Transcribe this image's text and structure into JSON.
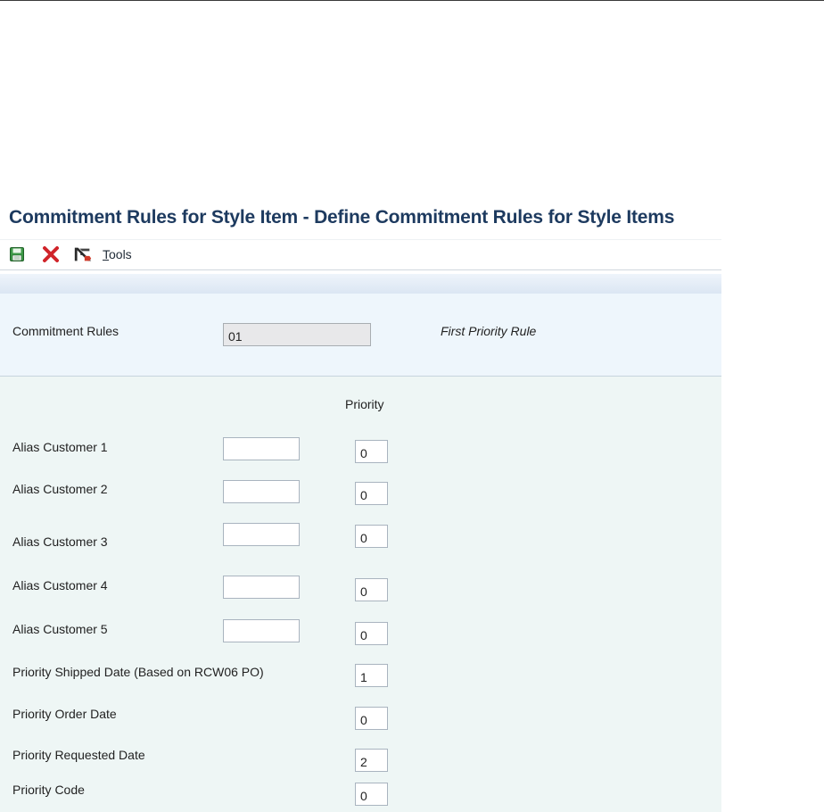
{
  "form": {
    "title": "Commitment Rules for Style Item - Define Commitment Rules for Style Items"
  },
  "toolbar": {
    "save_icon": "save-icon",
    "cancel_icon": "cancel-x-icon",
    "tools_icon": "tools-icon",
    "tools_label_accel": "T",
    "tools_label_rest": "ools"
  },
  "header": {
    "commitment_rules_label": "Commitment Rules",
    "commitment_rules_value": "01",
    "commitment_rules_description": "First Priority Rule"
  },
  "detail": {
    "priority_column_header": "Priority",
    "rows": [
      {
        "label": "Alias Customer 1",
        "alias_value": "",
        "priority": "0"
      },
      {
        "label": "Alias Customer 2",
        "alias_value": "",
        "priority": "0"
      },
      {
        "label": "Alias Customer 3",
        "alias_value": "",
        "priority": "0"
      },
      {
        "label": "Alias Customer 4",
        "alias_value": "",
        "priority": "0"
      },
      {
        "label": "Alias Customer 5",
        "alias_value": "",
        "priority": "0"
      },
      {
        "label": "Priority Shipped Date (Based on RCW06 PO)",
        "priority": "1"
      },
      {
        "label": "Priority Order Date",
        "priority": "0"
      },
      {
        "label": "Priority Requested Date",
        "priority": "2"
      },
      {
        "label": "Priority Code",
        "priority": "0"
      }
    ]
  },
  "colors": {
    "title": "#1d3a5f",
    "header_panel": "#eef6fc",
    "detail_panel": "#eef6f5",
    "cancel_red": "#d0242a",
    "save_green": "#2f8a3a"
  }
}
